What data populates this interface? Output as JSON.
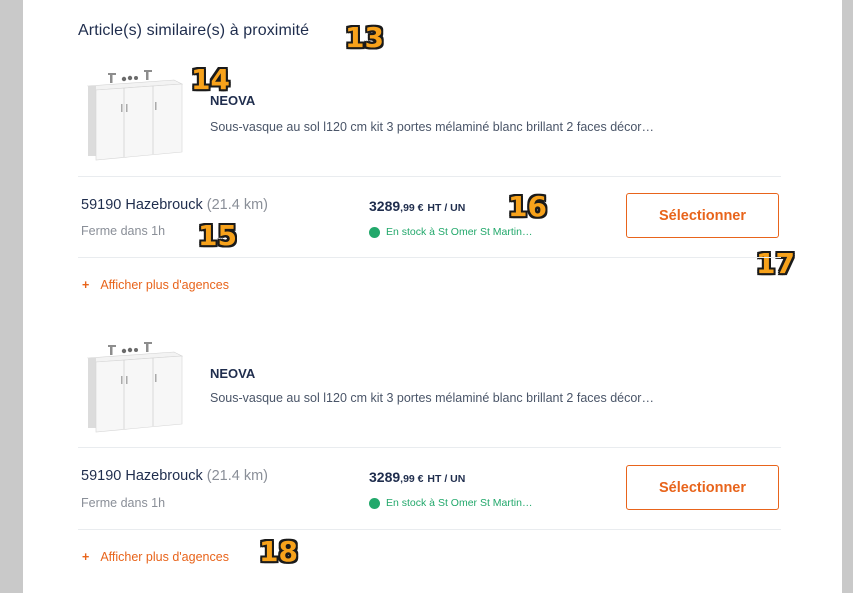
{
  "section": {
    "title": "Article(s) similaire(s) à proximité"
  },
  "badges": {
    "b13": "13",
    "b14": "14",
    "b15": "15",
    "b16": "16",
    "b17": "17",
    "b18": "18"
  },
  "items": [
    {
      "brand": "NEOVA",
      "description": "Sous-vasque au sol l120 cm kit 3 portes mélaminé blanc brillant 2 faces décor…",
      "city": "59190 Hazebrouck",
      "distance": "(21.4 km)",
      "hours": "Ferme dans 1h",
      "price_int": "3289",
      "price_cents": ",99 €",
      "price_unit": "HT / UN",
      "stock": "En stock à St Omer St Martin…",
      "select_label": "Sélectionner",
      "more_label": "Afficher plus d'agences",
      "more_plus": "+"
    },
    {
      "brand": "NEOVA",
      "description": "Sous-vasque au sol l120 cm kit 3 portes mélaminé blanc brillant 2 faces décor…",
      "city": "59190 Hazebrouck",
      "distance": "(21.4 km)",
      "hours": "Ferme dans 1h",
      "price_int": "3289",
      "price_cents": ",99 €",
      "price_unit": "HT / UN",
      "stock": "En stock à St Omer St Martin…",
      "select_label": "Sélectionner",
      "more_label": "Afficher plus d'agences",
      "more_plus": "+"
    }
  ],
  "colors": {
    "accent": "#e8641b",
    "stock_green": "#22a86b",
    "title_navy": "#1f2d4d"
  }
}
